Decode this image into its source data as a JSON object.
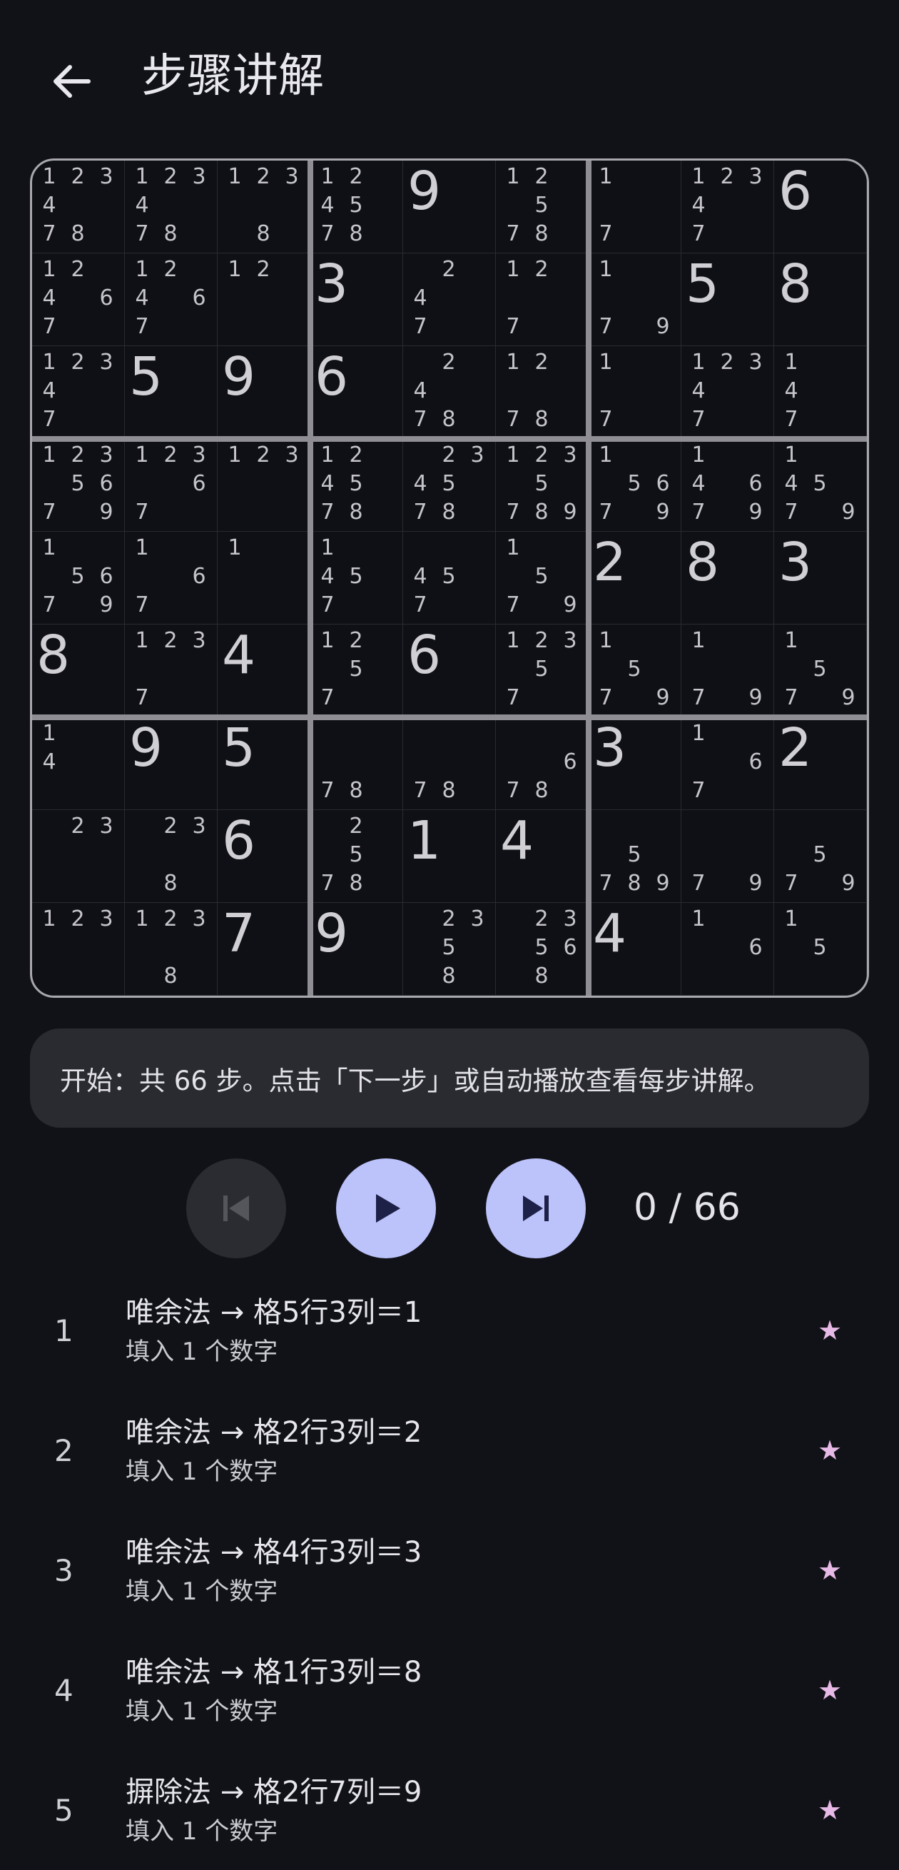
{
  "header": {
    "title": "步骤讲解"
  },
  "board": {
    "rows": [
      [
        {
          "c": "123478"
        },
        {
          "c": "123478"
        },
        {
          "c": "1238"
        },
        {
          "c": "124578"
        },
        {
          "v": "9"
        },
        {
          "c": "12578"
        },
        {
          "c": "17"
        },
        {
          "c": "12347"
        },
        {
          "v": "6"
        }
      ],
      [
        {
          "c": "12467"
        },
        {
          "c": "12467"
        },
        {
          "c": "12"
        },
        {
          "v": "3"
        },
        {
          "c": "247"
        },
        {
          "c": "127"
        },
        {
          "c": "179"
        },
        {
          "v": "5"
        },
        {
          "v": "8"
        }
      ],
      [
        {
          "c": "12347"
        },
        {
          "v": "5"
        },
        {
          "v": "9"
        },
        {
          "v": "6"
        },
        {
          "c": "2478"
        },
        {
          "c": "1278"
        },
        {
          "c": "17"
        },
        {
          "c": "12347"
        },
        {
          "c": "147"
        }
      ],
      [
        {
          "c": "1235679"
        },
        {
          "c": "12367"
        },
        {
          "c": "123"
        },
        {
          "c": "124578"
        },
        {
          "c": "234578"
        },
        {
          "c": "1235789"
        },
        {
          "c": "15679"
        },
        {
          "c": "14679"
        },
        {
          "c": "14579"
        }
      ],
      [
        {
          "c": "15679"
        },
        {
          "c": "167"
        },
        {
          "c": "1"
        },
        {
          "c": "1457"
        },
        {
          "c": "457"
        },
        {
          "c": "1579"
        },
        {
          "v": "2"
        },
        {
          "v": "8"
        },
        {
          "v": "3"
        }
      ],
      [
        {
          "v": "8"
        },
        {
          "c": "1237"
        },
        {
          "v": "4"
        },
        {
          "c": "1257"
        },
        {
          "v": "6"
        },
        {
          "c": "12357"
        },
        {
          "c": "1579"
        },
        {
          "c": "179"
        },
        {
          "c": "1579"
        }
      ],
      [
        {
          "c": "14"
        },
        {
          "v": "9"
        },
        {
          "v": "5"
        },
        {
          "c": "78"
        },
        {
          "c": "78"
        },
        {
          "c": "678"
        },
        {
          "v": "3"
        },
        {
          "c": "167"
        },
        {
          "v": "2"
        }
      ],
      [
        {
          "c": "23"
        },
        {
          "c": "238"
        },
        {
          "v": "6"
        },
        {
          "c": "2578"
        },
        {
          "v": "1"
        },
        {
          "v": "4"
        },
        {
          "c": "5789"
        },
        {
          "c": "79"
        },
        {
          "c": "579"
        }
      ],
      [
        {
          "c": "123"
        },
        {
          "c": "1238"
        },
        {
          "v": "7"
        },
        {
          "v": "9"
        },
        {
          "c": "2358"
        },
        {
          "c": "23568"
        },
        {
          "v": "4"
        },
        {
          "c": "16"
        },
        {
          "c": "15"
        }
      ]
    ]
  },
  "message": "开始：共 66 步。点击「下一步」或自动播放查看每步讲解。",
  "controls": {
    "counter": "0 / 66"
  },
  "steps": [
    {
      "num": "1",
      "title": "唯余法 → 格5行3列＝1",
      "subtitle": "填入 1 个数字",
      "star": "★"
    },
    {
      "num": "2",
      "title": "唯余法 → 格2行3列＝2",
      "subtitle": "填入 1 个数字",
      "star": "★"
    },
    {
      "num": "3",
      "title": "唯余法 → 格4行3列＝3",
      "subtitle": "填入 1 个数字",
      "star": "★"
    },
    {
      "num": "4",
      "title": "唯余法 → 格1行3列＝8",
      "subtitle": "填入 1 个数字",
      "star": "★"
    },
    {
      "num": "5",
      "title": "摒除法 → 格2行7列＝9",
      "subtitle": "填入 1 个数字",
      "star": "★"
    }
  ],
  "colors": {
    "background": "#111218",
    "accent": "#bcc2fa",
    "star": "#e7b9e6",
    "panel": "#2a2b31"
  }
}
